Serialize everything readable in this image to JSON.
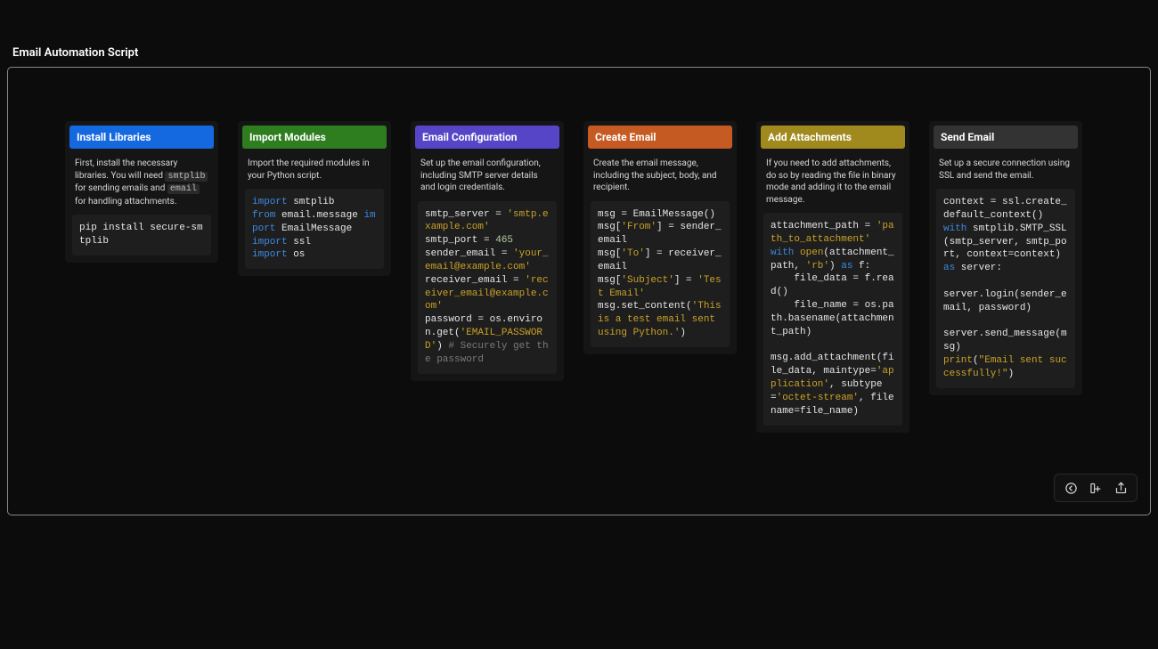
{
  "title": "Email Automation Script",
  "cards": [
    {
      "header": "Install Libraries",
      "desc_pre": "First, install the necessary libraries. You will need ",
      "desc_code1": "smtplib",
      "desc_mid": " for sending emails and ",
      "desc_code2": "email",
      "desc_post": " for handling attachments.",
      "code": {
        "l1": "pip install secure-smtplib"
      }
    },
    {
      "header": "Import Modules",
      "desc": "Import the required modules in your Python script.",
      "code": {
        "kw_import": "import",
        "kw_from": "from",
        "m1": " smtplib",
        "m2a": " email.message ",
        "m2b": " EmailMessage",
        "m3": " ssl",
        "m4": " os"
      }
    },
    {
      "header": "Email Configuration",
      "desc": "Set up the email configuration, including SMTP server details and login credentials.",
      "code": {
        "l1a": "smtp_server = ",
        "l1b": "'smtp.example.com'",
        "l2a": "smtp_port = ",
        "l2b": "465",
        "l3a": "sender_email = ",
        "l3b": "'your_email@example.com'",
        "l4a": "receiver_email = ",
        "l4b": "'receiver_email@example.com'",
        "l5a": "password = os.environ.get(",
        "l5b": "'EMAIL_PASSWORD'",
        "l5c": ") ",
        "l5d": "# Securely get the password"
      }
    },
    {
      "header": "Create Email",
      "desc": "Create the email message, including the subject, body, and recipient.",
      "code": {
        "l1": "msg = EmailMessage()",
        "l2a": "msg[",
        "l2b": "'From'",
        "l2c": "] = sender_email",
        "l3a": "msg[",
        "l3b": "'To'",
        "l3c": "] = receiver_email",
        "l4a": "msg[",
        "l4b": "'Subject'",
        "l4c": "] = ",
        "l4d": "'Test Email'",
        "l5a": "msg.set_content(",
        "l5b": "'This is a test email sent using Python.'",
        "l5c": ")"
      }
    },
    {
      "header": "Add Attachments",
      "desc": "If you need to add attachments, do so by reading the file in binary mode and adding it to the email message.",
      "code": {
        "l1a": "attachment_path = ",
        "l1b": "'path_to_attachment'",
        "kw_with": "with",
        "kw_as": "as",
        "fn_open": "open",
        "l2a": "(attachment_path, ",
        "l2b": "'rb'",
        "l2c": ") ",
        "l2d": " f:",
        "l3": "    file_data = f.read()",
        "l4": "    file_name = os.path.basename(attachment_path)",
        "blank": "",
        "l5a": "msg.add_attachment(file_data, maintype=",
        "l5b": "'application'",
        "l5c": ", subtype=",
        "l5d": "'octet-stream'",
        "l5e": ", filename=file_name)"
      }
    },
    {
      "header": "Send Email",
      "desc": "Set up a secure connection using SSL and send the email.",
      "code": {
        "l1": "context = ssl.create_default_context()",
        "kw_with": "with",
        "kw_as": "as",
        "l2a": " smtplib.SMTP_SSL(smtp_server, smtp_port, context=context) ",
        "l2b": " server:",
        "blank": "",
        "l3": "server.login(sender_email, password)",
        "l4": "server.send_message(msg)",
        "fn_print": "print",
        "l5a": "(",
        "l5b": "\"Email sent successfully!\"",
        "l5c": ")"
      }
    }
  ],
  "toolbar": {
    "back": "back",
    "add": "add",
    "share": "share"
  }
}
